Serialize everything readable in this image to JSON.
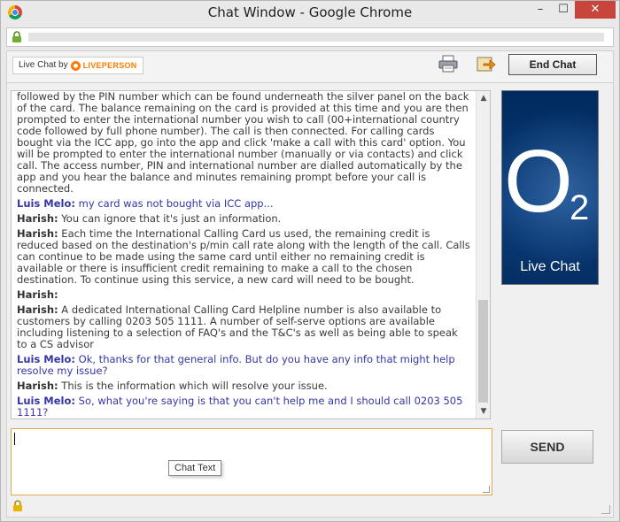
{
  "window": {
    "title": "Chat Window - Google Chrome",
    "minimize": "–",
    "maximize": "☐",
    "close": "✕"
  },
  "toolbar": {
    "live_chat_by": "Live Chat by",
    "liveperson": "LIVEPERSON",
    "end_chat_label": "End Chat"
  },
  "transcript": {
    "messages": [
      {
        "who": "",
        "role": "agent",
        "text": "followed by the PIN number which can be found underneath the silver panel on the back of the card. The balance remaining on the card is provided at this time and you are then prompted to enter the international number you wish to call (00+international country code followed by full phone number). The call is then connected. For calling cards bought via the ICC app, go into the app and click 'make a call with this card' option. You will be prompted to enter the international number (manually or via contacts) and click call. The access number, PIN and international number are dialled automatically by the app and you hear the balance and minutes remaining prompt before your call is connected."
      },
      {
        "who": "Luis Melo:",
        "role": "user",
        "text": "my card was not bought via ICC app..."
      },
      {
        "who": "Harish:",
        "role": "agent",
        "text": "You can ignore that it's just an information."
      },
      {
        "who": "Harish:",
        "role": "agent",
        "text": "Each time the International Calling Card us used, the remaining credit is reduced based on the destination's p/min call rate along with the length of the call. Calls can continue to be made using the same card until either no remaining credit is available or there is insufficient credit remaining to make a call to the chosen destination. To continue using this service, a new card will need to be bought."
      },
      {
        "who": "Harish:",
        "role": "agent",
        "text": ""
      },
      {
        "who": "Harish:",
        "role": "agent",
        "text": "A dedicated International Calling Card Helpline number is also available to customers by calling 0203 505 1111. A number of self-serve options are available including listening to a selection of FAQ's and the T&C's as well as being able to speak to a CS advisor"
      },
      {
        "who": "Luis Melo:",
        "role": "user",
        "text": "Ok, thanks for that general info. But do you have any info that might help resolve my issue?"
      },
      {
        "who": "Harish:",
        "role": "agent",
        "text": "This is the information which will resolve your issue."
      },
      {
        "who": "Luis Melo:",
        "role": "user",
        "text": "So, what you're saying is that you can't help me and I should call 0203 505 1111?"
      }
    ]
  },
  "side_panel": {
    "logo_o": "O",
    "logo_2": "2",
    "label": "Live Chat"
  },
  "input": {
    "tooltip": "Chat Text",
    "value": ""
  },
  "send_label": "SEND",
  "colors": {
    "user_text": "#3535a8",
    "agent_text": "#3a3a3a",
    "brand_blue": "#0a3d7c",
    "input_border": "#e0a84a",
    "liveperson_orange": "#ff7a00"
  }
}
